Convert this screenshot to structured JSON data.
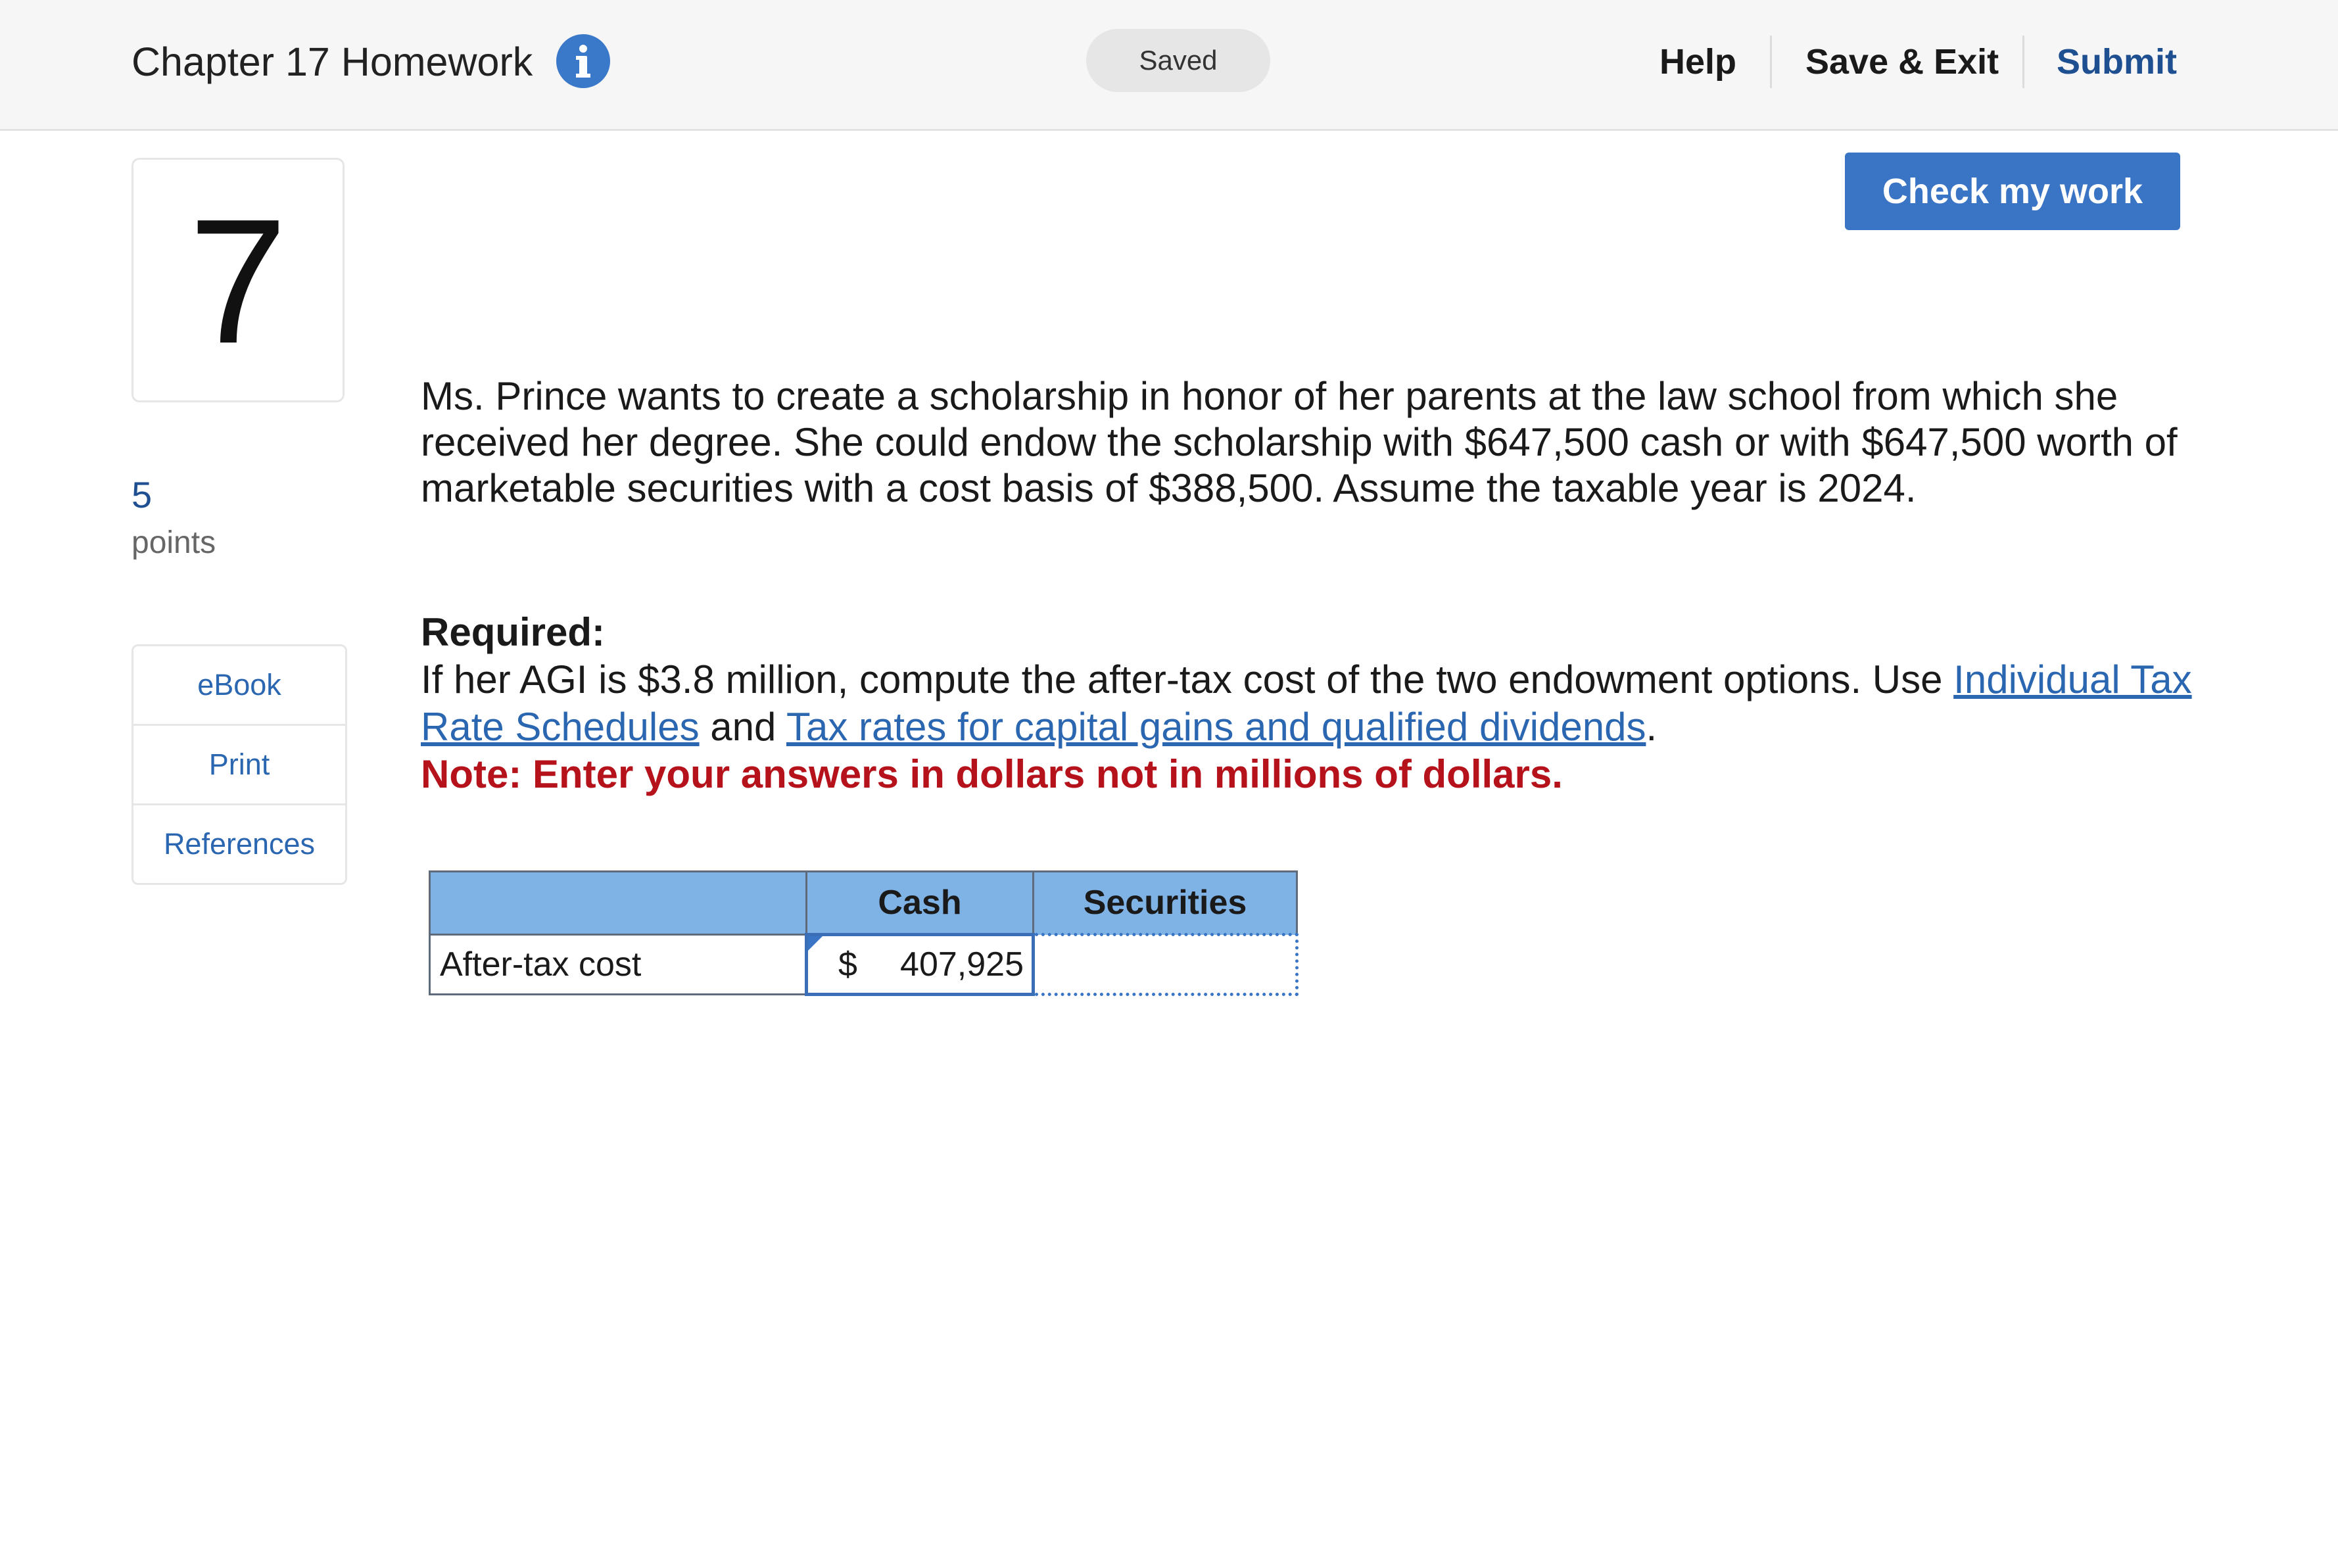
{
  "header": {
    "title": "Chapter 17 Homework",
    "status": "Saved",
    "help_label": "Help",
    "save_exit_label": "Save & Exit",
    "submit_label": "Submit"
  },
  "question": {
    "number": "7",
    "points_value": "5",
    "points_label": "points"
  },
  "tools": {
    "ebook": "eBook",
    "print": "Print",
    "references": "References"
  },
  "main": {
    "check_button": "Check my work",
    "problem_text": "Ms. Prince wants to create a scholarship in honor of her parents at the law school from which she received her degree. She could endow the scholarship with $647,500 cash or with $647,500 worth of marketable securities with a cost basis of $388,500. Assume the taxable year is 2024.",
    "required_label": "Required:",
    "required_text": "If her AGI is $3.8 million, compute the after-tax cost of the two endowment options. Use",
    "link1": "Individual Tax Rate Schedules",
    "and_text": "and",
    "link2": "Tax rates for capital gains and qualified dividends",
    "period": ".",
    "note": "Note: Enter your answers in dollars not in millions of dollars."
  },
  "table": {
    "col_blank": "",
    "col_cash": "Cash",
    "col_securities": "Securities",
    "row_label": "After-tax cost",
    "currency": "$",
    "cash_value": "407,925",
    "securities_value": ""
  }
}
